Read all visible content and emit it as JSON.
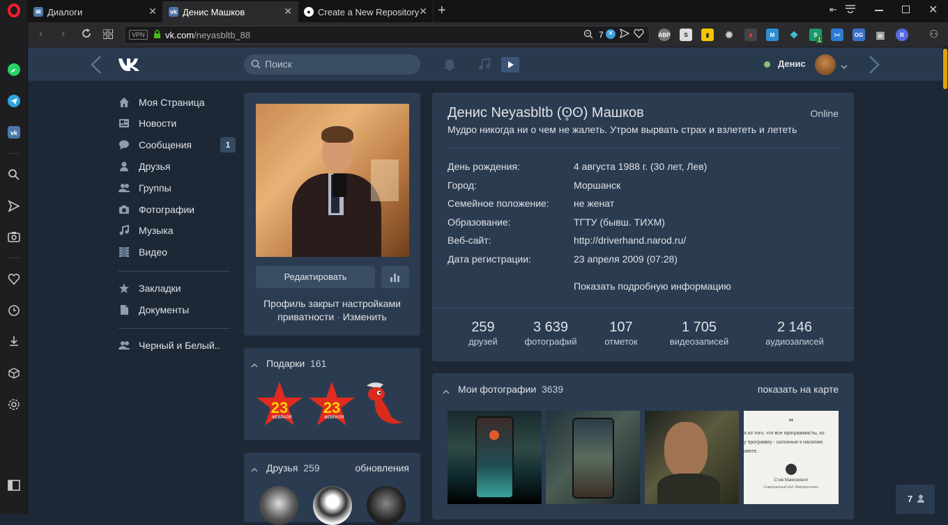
{
  "browser": {
    "tabs": [
      {
        "label": "Диалоги",
        "icon": "vk-icon"
      },
      {
        "label": "Денис Машков",
        "icon": "vk-icon"
      },
      {
        "label": "Create a New Repository",
        "icon": "github-icon"
      }
    ],
    "vpn_badge": "VPN",
    "url_domain": "vk.com",
    "url_path": "/neyasbltb_88",
    "tracker_count": "7",
    "ext_badge_count": "1",
    "ext_labels": {
      "adblock": "ABP",
      "s": "S",
      "m": "M",
      "og": "OG",
      "r": "R",
      "arrows": "><"
    }
  },
  "vk": {
    "search_placeholder": "Поиск",
    "user_name": "Денис",
    "nav": [
      {
        "label": "Моя Страница"
      },
      {
        "label": "Новости"
      },
      {
        "label": "Сообщения",
        "badge": "1"
      },
      {
        "label": "Друзья"
      },
      {
        "label": "Группы"
      },
      {
        "label": "Фотографии"
      },
      {
        "label": "Музыка"
      },
      {
        "label": "Видео"
      },
      {
        "label": "Закладки"
      },
      {
        "label": "Документы"
      },
      {
        "label": "Черный и Белый.."
      }
    ],
    "edit_button": "Редактировать",
    "privacy_text": "Профиль закрыт настройками",
    "privacy_text2": "приватности",
    "privacy_sep": "·",
    "privacy_link": "Изменить",
    "gifts": {
      "title": "Подарки",
      "count": "161",
      "star_text": "23",
      "star_sub": "ФЕВРАЛЯ"
    },
    "friends": {
      "title": "Друзья",
      "count": "259",
      "updates": "обновления"
    },
    "profile": {
      "name": "Денис Neyasbltb (ʘ̥ʘ) Машков",
      "online": "Online",
      "status": "Мудро никогда ни о чем не жалеть. Утром вырвать страх и взлететь и лететь",
      "info": [
        {
          "label": "День рождения:",
          "value": "4 августа 1988 г. (30 лет, Лев)"
        },
        {
          "label": "Город:",
          "value": "Моршанск"
        },
        {
          "label": "Семейное положение:",
          "value": "не женат"
        },
        {
          "label": "Образование:",
          "value": "ТГТУ (бывш. ТИХМ)"
        },
        {
          "label": "Веб-сайт:",
          "value": "http://driverhand.narod.ru/"
        },
        {
          "label": "Дата регистрации:",
          "value": "23 апреля 2009 (07:28)"
        }
      ],
      "more": "Показать подробную информацию",
      "counters": [
        {
          "num": "259",
          "label": "друзей"
        },
        {
          "num": "3 639",
          "label": "фотографий"
        },
        {
          "num": "107",
          "label": "отметок"
        },
        {
          "num": "1 705",
          "label": "видеозаписей"
        },
        {
          "num": "2 146",
          "label": "аудиозаписей"
        }
      ]
    },
    "photos": {
      "title": "Мои фотографии",
      "count": "3639",
      "map": "показать на карте",
      "quote_lines": [
        "я из того, что все программисты, ко",
        "у программу - склонные к насилию",
        "ивете."
      ],
      "quote_author": "Стив Макконнелл",
      "quote_book": "Совершенный код. Мастер-класс"
    },
    "friends_online_count": "7"
  }
}
